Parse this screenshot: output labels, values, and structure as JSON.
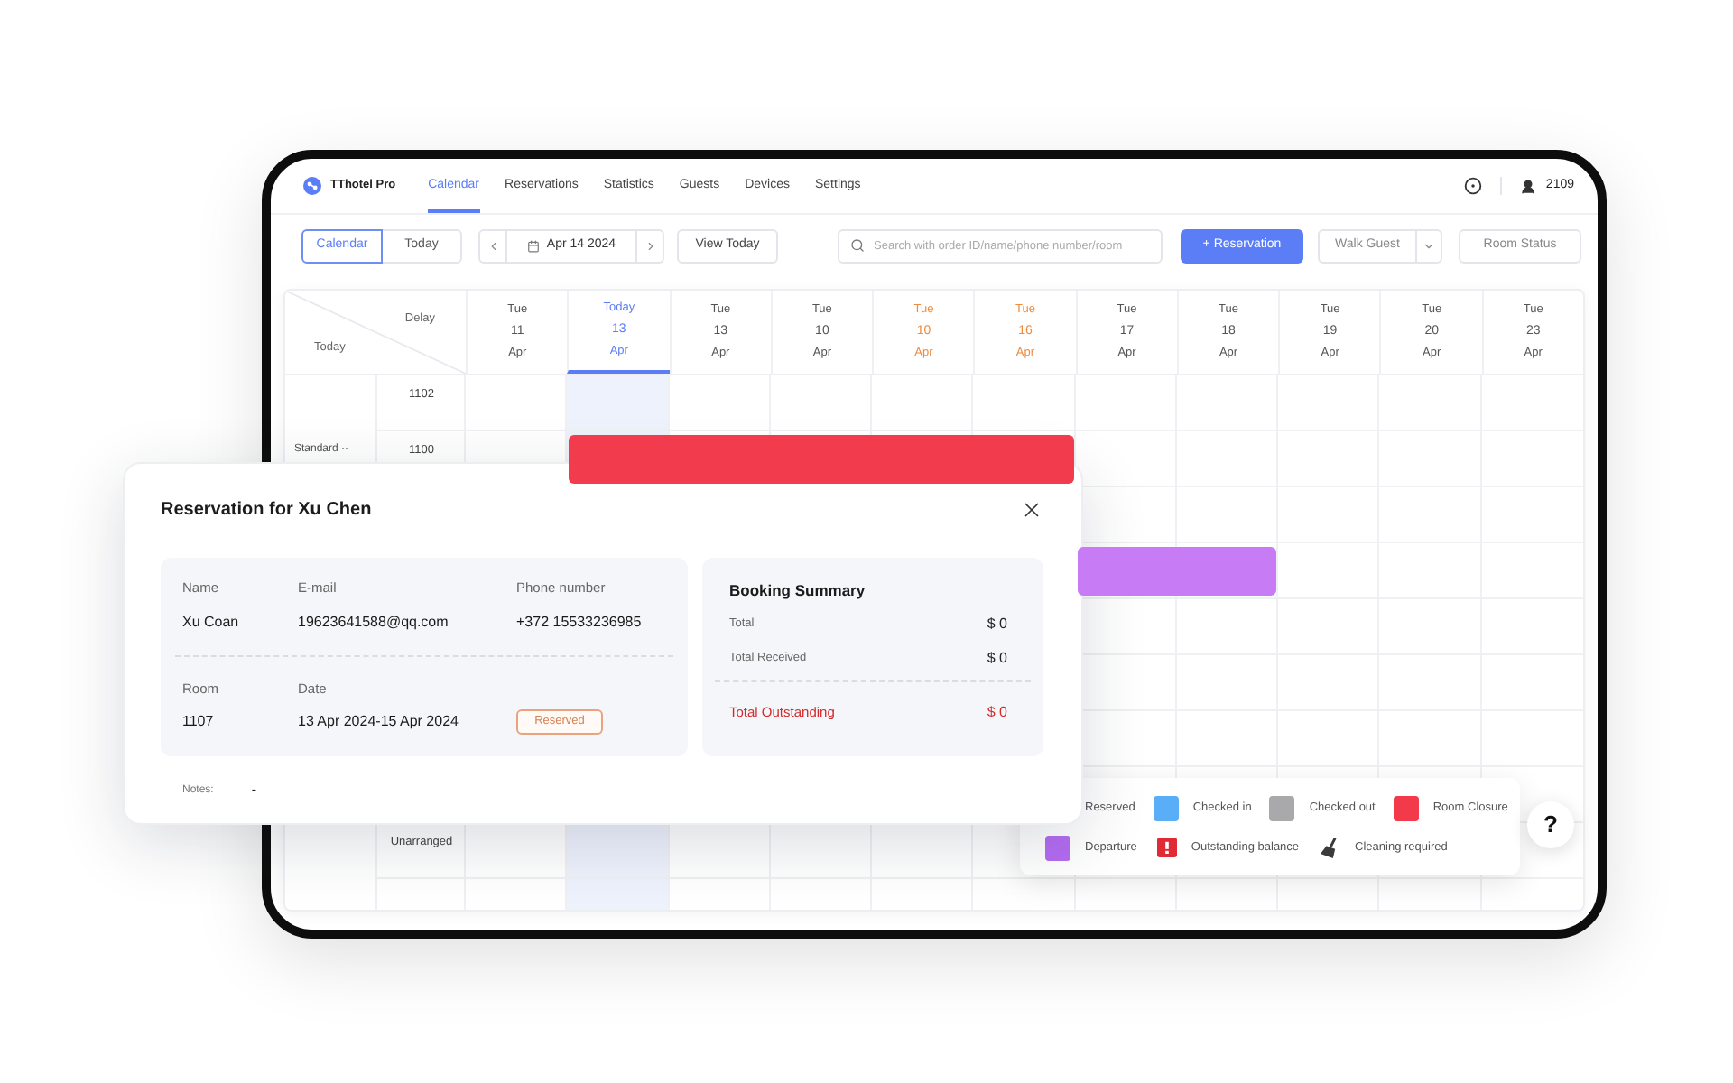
{
  "app": {
    "brand": "TThotel Pro",
    "user": "2109"
  },
  "nav_tabs": [
    {
      "label": "Calendar",
      "selected": true
    },
    {
      "label": "Reservations",
      "selected": false
    },
    {
      "label": "Statistics",
      "selected": false
    },
    {
      "label": "Guests",
      "selected": false
    },
    {
      "label": "Devices",
      "selected": false
    },
    {
      "label": "Settings",
      "selected": false
    }
  ],
  "toolbar": {
    "view_toggle": [
      {
        "label": "Calendar",
        "selected": true
      },
      {
        "label": "Today",
        "selected": false
      }
    ],
    "date": "Apr 14 2024",
    "view_today": "View Today",
    "search": {
      "placeholder": "Search with order ID/name/phone number/room"
    },
    "new_reservation": "+ Reservation",
    "walk_in": "Walk Guest",
    "room_status": "Room Status"
  },
  "calendar": {
    "corner": {
      "top": "Delay",
      "bottom": "Today"
    },
    "dates": [
      {
        "weekday": "Tue",
        "day": "11",
        "month": "Apr",
        "selected": false,
        "weekend": false
      },
      {
        "weekday": "Today",
        "day": "13",
        "month": "Apr",
        "selected": true,
        "weekend": false
      },
      {
        "weekday": "Tue",
        "day": "13",
        "month": "Apr",
        "selected": false,
        "weekend": false
      },
      {
        "weekday": "Tue",
        "day": "10",
        "month": "Apr",
        "selected": false,
        "weekend": false
      },
      {
        "weekday": "Tue",
        "day": "10",
        "month": "Apr",
        "selected": false,
        "weekend": true
      },
      {
        "weekday": "Tue",
        "day": "16",
        "month": "Apr",
        "selected": false,
        "weekend": true
      },
      {
        "weekday": "Tue",
        "day": "17",
        "month": "Apr",
        "selected": false,
        "weekend": false
      },
      {
        "weekday": "Tue",
        "day": "18",
        "month": "Apr",
        "selected": false,
        "weekend": false
      },
      {
        "weekday": "Tue",
        "day": "19",
        "month": "Apr",
        "selected": false,
        "weekend": false
      },
      {
        "weekday": "Tue",
        "day": "20",
        "month": "Apr",
        "selected": false,
        "weekend": false
      },
      {
        "weekday": "Tue",
        "day": "23",
        "month": "Apr",
        "selected": false,
        "weekend": false
      }
    ],
    "rows": [
      {
        "room": "1102"
      },
      {
        "group": "Standard ··",
        "room": "1100",
        "bookings": [
          {
            "color": "#f23b4c"
          }
        ]
      },
      {},
      {
        "bookings": [
          {
            "color": "#c77bf5"
          }
        ]
      },
      {},
      {},
      {},
      {},
      {
        "room": "Unarranged"
      },
      {}
    ]
  },
  "reservation_dialog": {
    "title": "Reservation for Xu Chen",
    "guest_fields": [
      {
        "label": "Name",
        "value": "Xu Coan"
      },
      {
        "label": "E-mail",
        "value": "19623641588@qq.com"
      },
      {
        "label": "Phone number",
        "value": "+372 15533236985"
      }
    ],
    "stay_fields": [
      {
        "label": "Room",
        "value": "1107"
      },
      {
        "label": "Date",
        "value": "13 Apr 2024-15 Apr 2024"
      }
    ],
    "status_badge": "Reserved",
    "summary": {
      "title": "Booking Summary",
      "lines": [
        {
          "label": "Total",
          "amount": "$ 0"
        },
        {
          "label": "Total Received",
          "amount": "$ 0"
        }
      ],
      "outstanding": {
        "label": "Total Outstanding",
        "amount": "$ 0"
      }
    },
    "notes": {
      "label": "Notes:",
      "value": "-"
    }
  },
  "legend": {
    "rows": [
      {
        "items": [
          {
            "kind": "swatch",
            "label": "Reserved"
          },
          {
            "kind": "swatch",
            "color": "#5aaef7",
            "label": "Checked in"
          },
          {
            "kind": "swatch",
            "color": "#a9a9ab",
            "label": "Checked out"
          },
          {
            "kind": "swatch",
            "color": "#f23a4a",
            "label": "Room Closure"
          }
        ]
      },
      {
        "items": [
          {
            "kind": "swatch",
            "color": "#b46cf2",
            "label": "Departure"
          },
          {
            "kind": "balance",
            "label": "Outstanding balance"
          },
          {
            "kind": "cleaning",
            "label": "Cleaning required"
          }
        ]
      }
    ]
  },
  "help_button": {
    "label": "?"
  }
}
